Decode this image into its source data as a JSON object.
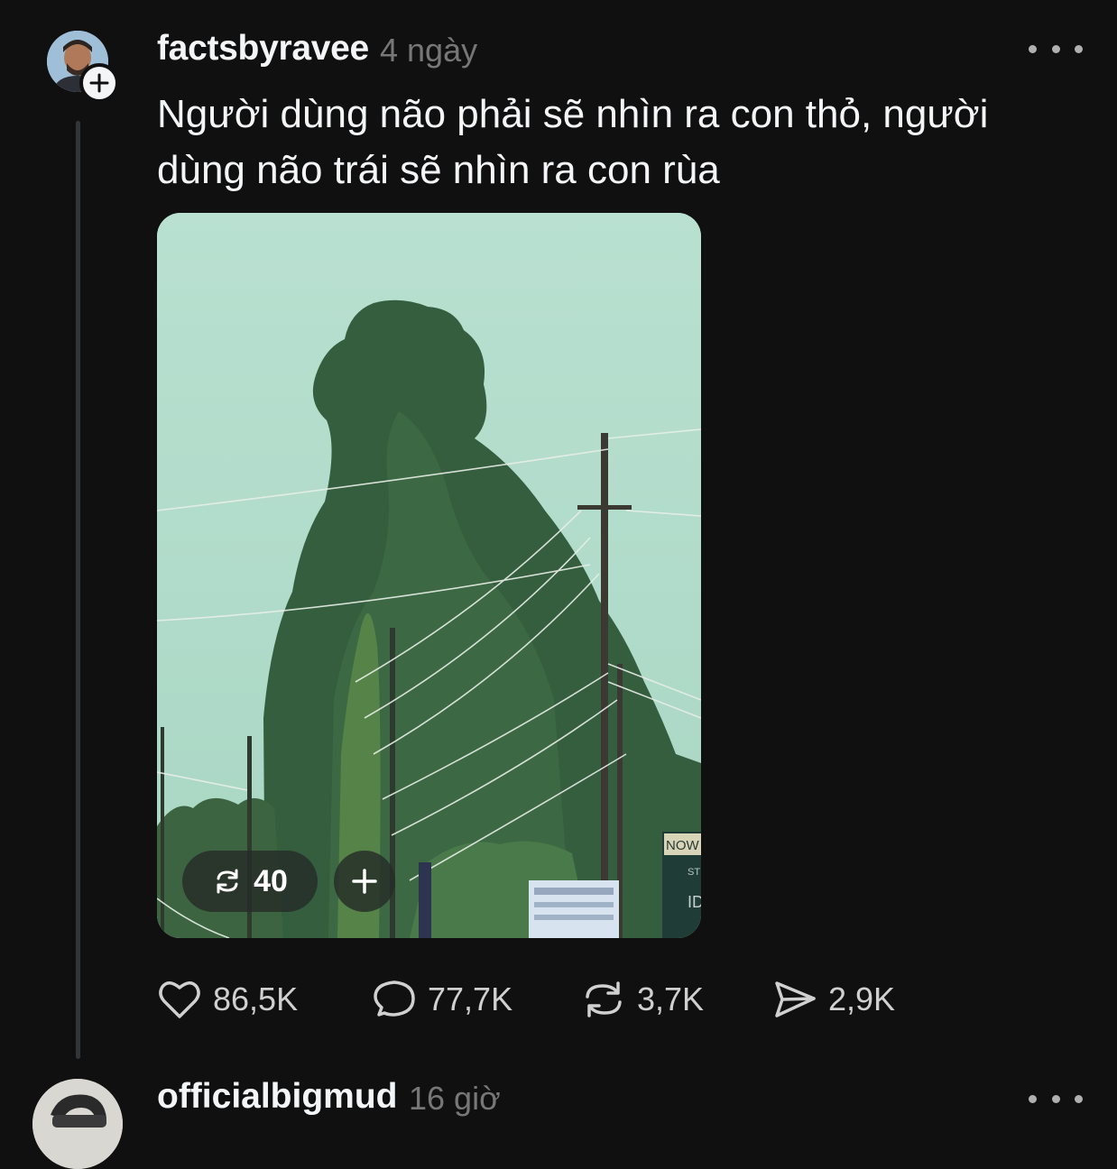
{
  "post": {
    "username": "factsbyravee",
    "time": "4 ngày",
    "caption": "Người dùng não phải sẽ nhìn ra con thỏ, người dùng não trái sẽ nhìn ra con rùa",
    "media": {
      "repost_count": "40",
      "photo_signs": [
        "NOW",
        "ST",
        "ID"
      ]
    },
    "actions": {
      "likes": "86,5K",
      "comments": "77,7K",
      "reposts": "3,7K",
      "shares": "2,9K"
    }
  },
  "next_post": {
    "username": "officialbigmud",
    "time": "16 giờ"
  },
  "icons": {
    "more": "more-dots-icon",
    "follow": "plus-icon",
    "like": "heart-icon",
    "comment": "comment-bubble-icon",
    "repost": "repost-icon",
    "share": "send-icon"
  },
  "colors": {
    "background": "#101010",
    "text": "#f3f5f7",
    "muted": "#777777",
    "thread_line": "#333638"
  }
}
